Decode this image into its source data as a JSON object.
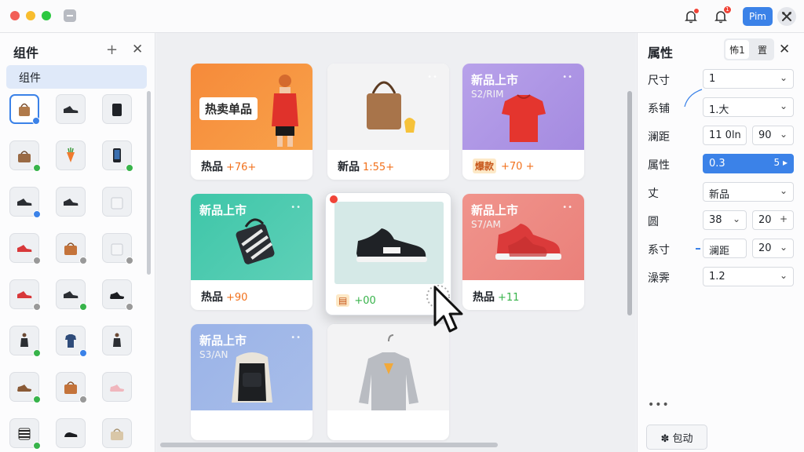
{
  "titlebar": {
    "icons": [
      "bell-icon",
      "bell-icon",
      "tools-icon"
    ],
    "notification_badge": "1",
    "user_button": "Pim"
  },
  "left_panel": {
    "title": "组件",
    "tab": "组件",
    "items": [
      {
        "icon": "tote-bag",
        "badge": "#3b82e8"
      },
      {
        "icon": "sneaker",
        "badge": null
      },
      {
        "icon": "black-bag",
        "badge": null
      },
      {
        "icon": "handbag",
        "badge": "#37b34a"
      },
      {
        "icon": "carrot",
        "badge": null
      },
      {
        "icon": "phone",
        "badge": "#37b34a"
      },
      {
        "icon": "sneaker",
        "badge": "#3b82e8"
      },
      {
        "icon": "sneaker",
        "badge": null
      },
      {
        "icon": "white-bag",
        "badge": null
      },
      {
        "icon": "red-sneaker",
        "badge": "#999999"
      },
      {
        "icon": "orange-bag",
        "badge": "#999999"
      },
      {
        "icon": "white-bag",
        "badge": "#999999"
      },
      {
        "icon": "red-sneaker",
        "badge": "#999999"
      },
      {
        "icon": "sneaker",
        "badge": "#37b34a"
      },
      {
        "icon": "black-shoe",
        "badge": "#999999"
      },
      {
        "icon": "person",
        "badge": "#37b34a"
      },
      {
        "icon": "shirt",
        "badge": "#3b82e8"
      },
      {
        "icon": "person",
        "badge": null
      },
      {
        "icon": "brown-shoe",
        "badge": "#37b34a"
      },
      {
        "icon": "orange-bag",
        "badge": "#999999"
      },
      {
        "icon": "pink-shoe",
        "badge": null
      },
      {
        "icon": "zebra",
        "badge": "#37b34a"
      },
      {
        "icon": "slipper",
        "badge": null
      },
      {
        "icon": "beige-bag",
        "badge": null
      }
    ]
  },
  "cards": [
    {
      "theme": "orange",
      "hot_label": "热卖单品",
      "title": "",
      "sub": "",
      "dots": "",
      "footer_label": "热品",
      "footer_tag": "",
      "footer_value": "+76+",
      "value_color": "orange",
      "image": "person-red-jacket"
    },
    {
      "theme": "white",
      "hot_label": "",
      "title": "",
      "sub": "",
      "dots": "••",
      "footer_label": "新品",
      "footer_tag": "",
      "footer_value": "1:55+",
      "value_color": "orange",
      "image": "brown-tote"
    },
    {
      "theme": "purple",
      "hot_label": "",
      "title": "新品上市",
      "sub": "S2/RIM",
      "dots": "••",
      "footer_label": "",
      "footer_tag": "爆款",
      "footer_value": "+70 +",
      "value_color": "orange",
      "image": "red-tshirt"
    },
    {
      "theme": "teal",
      "hot_label": "",
      "title": "新品上市",
      "sub": "",
      "dots": "••",
      "footer_label": "热品",
      "footer_tag": "",
      "footer_value": "+90",
      "value_color": "orange",
      "image": "patterned-bag"
    },
    {
      "theme": "selected",
      "hot_label": "",
      "title": "",
      "sub": "",
      "dots": "",
      "footer_label": "",
      "footer_tag": "",
      "footer_value": "+00",
      "value_color": "green",
      "image": "black-sneaker"
    },
    {
      "theme": "red",
      "hot_label": "",
      "title": "新品上市",
      "sub": "S7/AM",
      "dots": "••",
      "footer_label": "热品",
      "footer_tag": "",
      "footer_value": "+11",
      "value_color": "green",
      "image": "red-sneaker"
    },
    {
      "theme": "blue",
      "hot_label": "",
      "title": "新品上市",
      "sub": "S3/AN",
      "dots": "••",
      "footer_label": "",
      "footer_tag": "",
      "footer_value": "",
      "value_color": "orange",
      "image": "black-vest"
    },
    {
      "theme": "white",
      "hot_label": "",
      "title": "",
      "sub": "",
      "dots": "",
      "footer_label": "",
      "footer_tag": "",
      "footer_value": "",
      "value_color": "orange",
      "image": "grey-sweater"
    }
  ],
  "right_panel": {
    "title": "属性",
    "seg": [
      "怖1",
      "置"
    ],
    "props": [
      {
        "label": "尺寸",
        "fields": [
          {
            "value": "1",
            "chev": "⌄",
            "active": false
          }
        ]
      },
      {
        "label": "系铺",
        "fields": [
          {
            "value": "1.大",
            "chev": "⌄",
            "active": false
          }
        ]
      },
      {
        "label": "澜距",
        "fields": [
          {
            "value": "11  0ln",
            "chev": "",
            "active": false
          },
          {
            "value": "90",
            "chev": "⌄",
            "active": false
          }
        ]
      },
      {
        "label": "属性",
        "fields": [
          {
            "value": "0.3",
            "chev": "5 ▸",
            "active": true
          }
        ]
      },
      {
        "label": "丈",
        "fields": [
          {
            "value": "新品",
            "chev": "⌄",
            "active": false
          }
        ]
      },
      {
        "label": "圆",
        "fields": [
          {
            "value": "38",
            "chev": "⌄",
            "active": false
          },
          {
            "value": "20",
            "chev": "+",
            "active": false
          }
        ]
      },
      {
        "label": "系寸",
        "fields": [
          {
            "value": "澜距",
            "chev": "",
            "active": false
          },
          {
            "value": "20",
            "chev": "⌄",
            "active": false
          }
        ]
      },
      {
        "label": "澡霁",
        "fields": [
          {
            "value": "1.2",
            "chev": "⌄",
            "active": false
          }
        ]
      }
    ],
    "more": "•••",
    "apply_button": "✽ 包动"
  }
}
